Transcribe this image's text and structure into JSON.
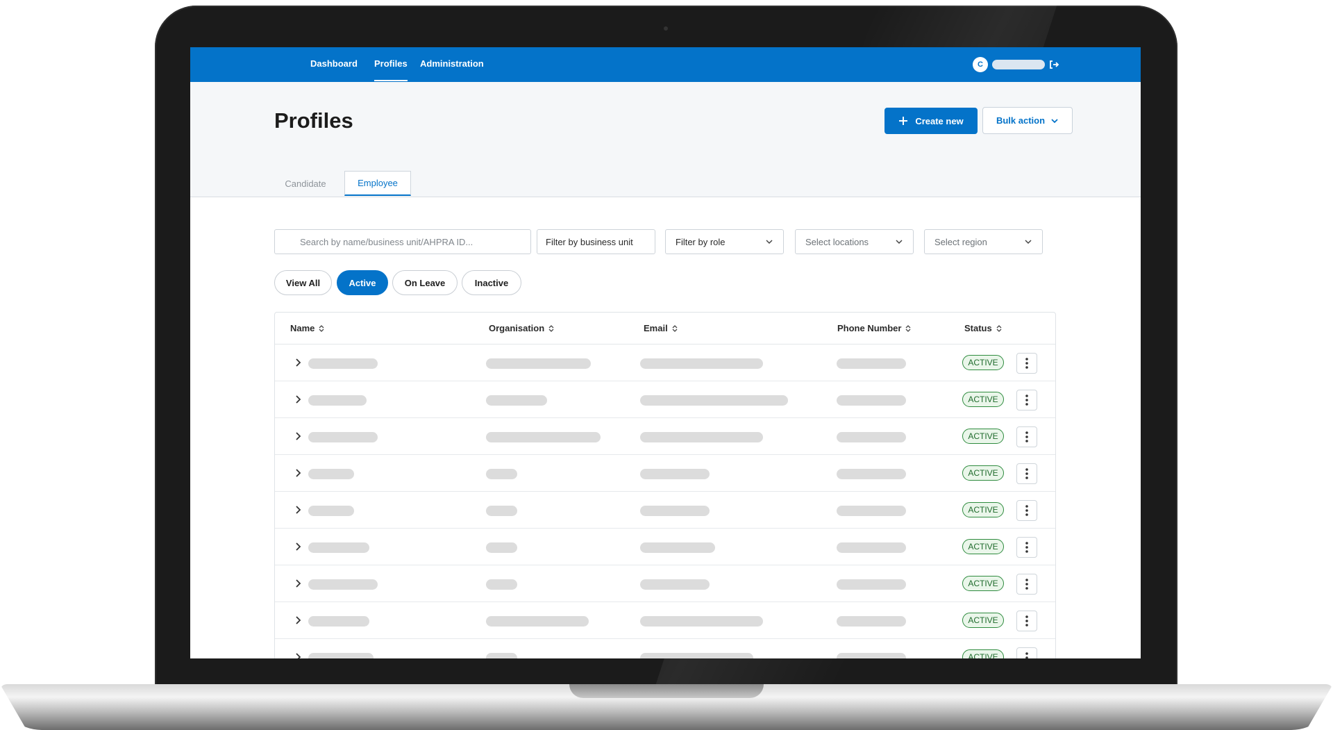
{
  "nav": {
    "items": [
      "Dashboard",
      "Profiles",
      "Administration"
    ],
    "active": "Profiles",
    "avatar_initial": "C"
  },
  "page": {
    "title": "Profiles",
    "create_label": "Create new",
    "bulk_label": "Bulk action"
  },
  "tabs": [
    {
      "label": "Candidate",
      "active": false
    },
    {
      "label": "Employee",
      "active": true
    }
  ],
  "filters": {
    "search_placeholder": "Search by name/business unit/AHPRA ID...",
    "business_unit": "Filter by business unit",
    "role": "Filter by role",
    "locations": "Select locations",
    "region": "Select region"
  },
  "status_filters": [
    {
      "label": "View All",
      "active": false
    },
    {
      "label": "Active",
      "active": true
    },
    {
      "label": "On Leave",
      "active": false
    },
    {
      "label": "Inactive",
      "active": false
    }
  ],
  "table": {
    "columns": [
      "Name",
      "Organisation",
      "Email",
      "Phone Number",
      "Status"
    ],
    "rows": [
      {
        "status": "ACTIVE"
      },
      {
        "status": "ACTIVE"
      },
      {
        "status": "ACTIVE"
      },
      {
        "status": "ACTIVE"
      },
      {
        "status": "ACTIVE"
      },
      {
        "status": "ACTIVE"
      },
      {
        "status": "ACTIVE"
      },
      {
        "status": "ACTIVE"
      },
      {
        "status": "ACTIVE"
      }
    ]
  },
  "colors": {
    "brand_blue": "#0473c9",
    "active_green": "#2e8b3e",
    "placeholder_gray": "#dcdcdc"
  },
  "icons": [
    "plus-icon",
    "chevron-down-icon",
    "sort-icon",
    "chevron-right-icon",
    "kebab-icon",
    "logout-icon"
  ]
}
